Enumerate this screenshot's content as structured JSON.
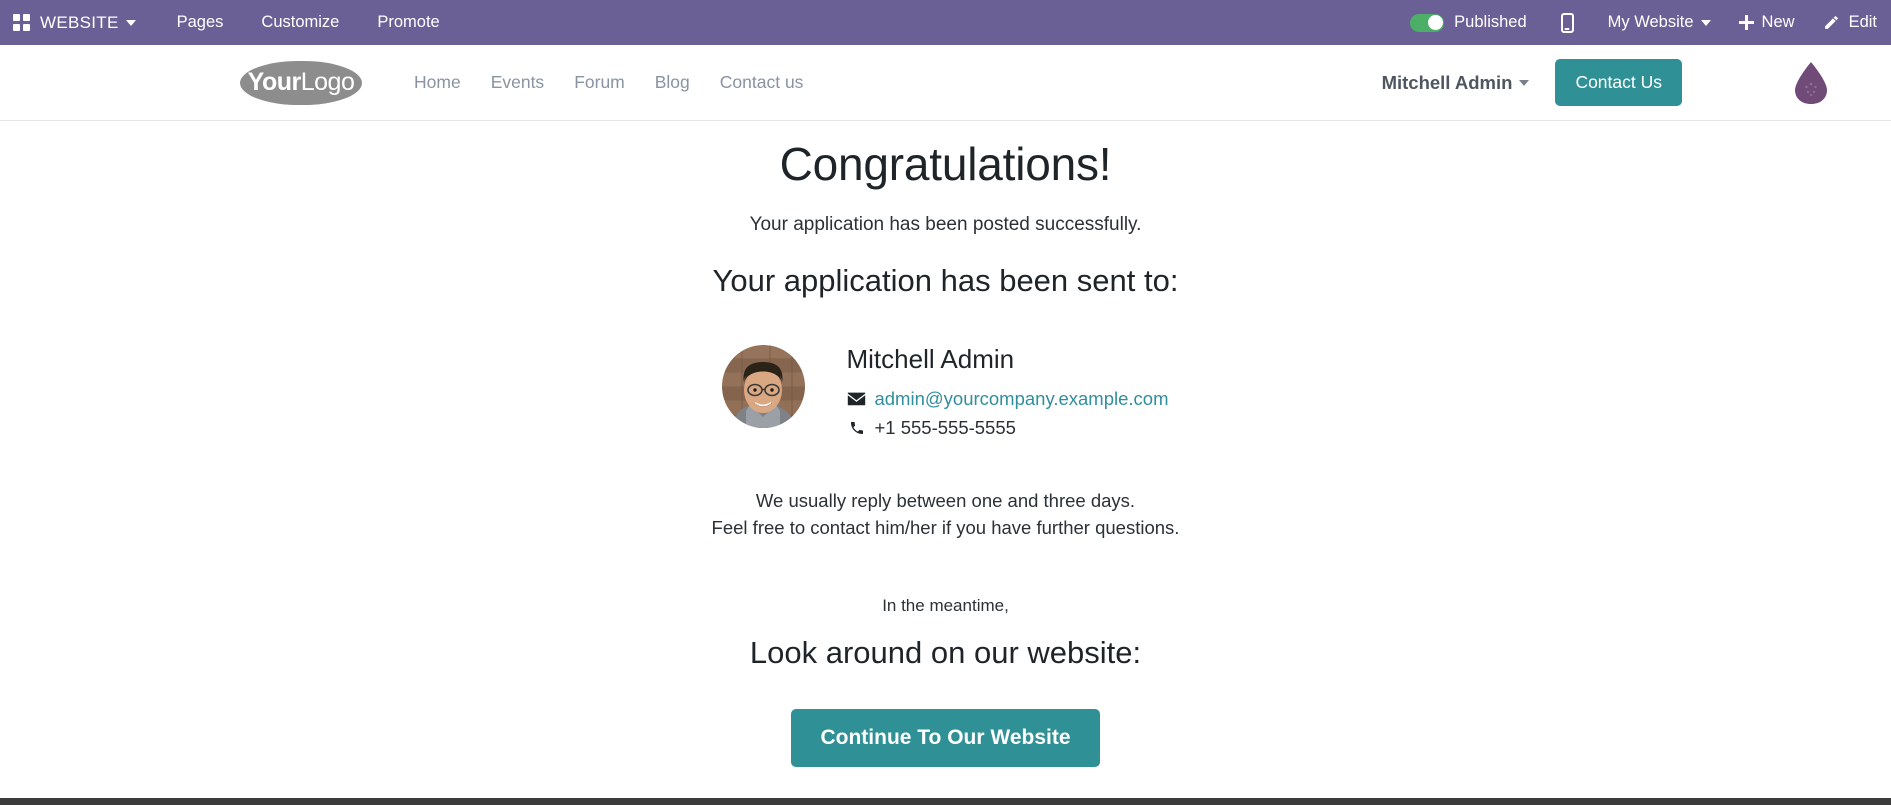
{
  "editor_topbar": {
    "apps_icon": "apps-grid-icon",
    "brand": "WEBSITE",
    "menu_items": [
      {
        "label": "Pages"
      },
      {
        "label": "Customize"
      },
      {
        "label": "Promote"
      }
    ],
    "publish": {
      "state": "on",
      "label": "Published",
      "toggle_color": "#4caf68"
    },
    "mobile_preview_icon": "mobile-phone-icon",
    "website_selector": "My Website",
    "new_button": {
      "icon": "plus-icon",
      "label": "New"
    },
    "edit_button": {
      "icon": "pencil-icon",
      "label": "Edit"
    },
    "background_color": "#6b6095"
  },
  "site_navbar": {
    "logo": {
      "strong": "Your",
      "light": "Logo"
    },
    "links": [
      {
        "label": "Home"
      },
      {
        "label": "Events"
      },
      {
        "label": "Forum"
      },
      {
        "label": "Blog"
      },
      {
        "label": "Contact us"
      }
    ],
    "user_menu": "Mitchell Admin",
    "contact_button": "Contact Us",
    "droplet_icon": "droplet-icon",
    "droplet_color": "#714b78",
    "accent_color": "#2f9196"
  },
  "main": {
    "congrats_heading": "Congratulations!",
    "posted_success": "Your application has been posted successfully.",
    "sent_to_heading": "Your application has been sent to:",
    "contact": {
      "avatar_icon": "user-avatar-photo",
      "name": "Mitchell Admin",
      "email_icon": "envelope-icon",
      "email": "admin@yourcompany.example.com",
      "phone_icon": "phone-icon",
      "phone": "+1 555-555-5555"
    },
    "reply_time": "We usually reply between one and three days.",
    "further_questions": "Feel free to contact him/her if you have further questions.",
    "meantime": "In the meantime,",
    "look_around_heading": "Look around on our website:",
    "continue_button": "Continue To Our Website"
  }
}
